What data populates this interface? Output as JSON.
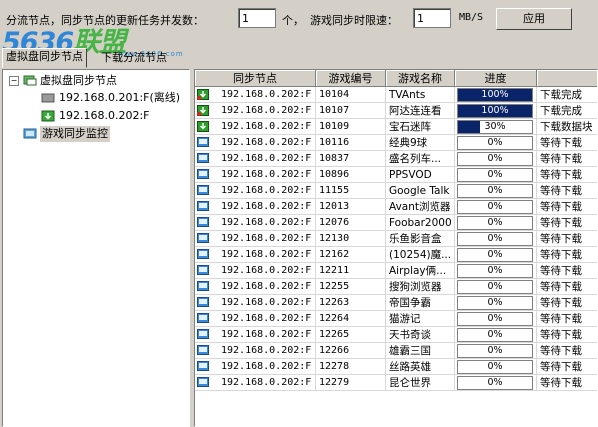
{
  "toolbar": {
    "concurrency_label": "分流节点，同步节点的更新任务并发数：",
    "concurrency_value": "1",
    "concurrency_unit": "个，",
    "speed_label": "游戏同步时限速：",
    "speed_value": "1",
    "speed_unit": "MB/S",
    "apply_label": "应用"
  },
  "watermark": {
    "logo_num": "5636",
    "logo_cn": "联盟",
    "logo_sub": "www.5636.com"
  },
  "tabs": [
    {
      "label": "虚拟盘同步节点"
    },
    {
      "label": "下载分流节点"
    }
  ],
  "tree": {
    "root": "虚拟盘同步节点",
    "children": [
      {
        "label": "192.168.0.201:F(离线)",
        "status": "offline"
      },
      {
        "label": "192.168.0.202:F",
        "status": "online"
      }
    ],
    "monitor": "游戏同步监控"
  },
  "grid": {
    "columns": [
      "同步节点",
      "游戏编号",
      "游戏名称",
      "进度",
      ""
    ],
    "rows": [
      {
        "node": "192.168.0.202:F",
        "id": "10104",
        "name": "TVAnts",
        "progress": 100,
        "progress_text": "100%",
        "status": "下载完成",
        "icon": "download-complete-icon"
      },
      {
        "node": "192.168.0.202:F",
        "id": "10107",
        "name": "阿达连连看",
        "progress": 100,
        "progress_text": "100%",
        "status": "下载完成",
        "icon": "download-complete-icon"
      },
      {
        "node": "192.168.0.202:F",
        "id": "10109",
        "name": "宝石迷阵",
        "progress": 30,
        "progress_text": "30%",
        "status": "下载数据块",
        "icon": "downloading-icon"
      },
      {
        "node": "192.168.0.202:F",
        "id": "10116",
        "name": "经典9球",
        "progress": 0,
        "progress_text": "0%",
        "status": "等待下载",
        "icon": "waiting-icon"
      },
      {
        "node": "192.168.0.202:F",
        "id": "10837",
        "name": "盛名列车...",
        "progress": 0,
        "progress_text": "0%",
        "status": "等待下载",
        "icon": "waiting-icon"
      },
      {
        "node": "192.168.0.202:F",
        "id": "10896",
        "name": "PPSVOD",
        "progress": 0,
        "progress_text": "0%",
        "status": "等待下载",
        "icon": "waiting-icon"
      },
      {
        "node": "192.168.0.202:F",
        "id": "11155",
        "name": "Google Talk",
        "progress": 0,
        "progress_text": "0%",
        "status": "等待下载",
        "icon": "waiting-icon"
      },
      {
        "node": "192.168.0.202:F",
        "id": "12013",
        "name": "Avant浏览器",
        "progress": 0,
        "progress_text": "0%",
        "status": "等待下载",
        "icon": "waiting-icon"
      },
      {
        "node": "192.168.0.202:F",
        "id": "12076",
        "name": "Foobar2000",
        "progress": 0,
        "progress_text": "0%",
        "status": "等待下载",
        "icon": "waiting-icon"
      },
      {
        "node": "192.168.0.202:F",
        "id": "12130",
        "name": "乐鱼影音盒",
        "progress": 0,
        "progress_text": "0%",
        "status": "等待下载",
        "icon": "waiting-icon"
      },
      {
        "node": "192.168.0.202:F",
        "id": "12162",
        "name": "(10254)魔...",
        "progress": 0,
        "progress_text": "0%",
        "status": "等待下载",
        "icon": "waiting-icon"
      },
      {
        "node": "192.168.0.202:F",
        "id": "12211",
        "name": "Airplay俩...",
        "progress": 0,
        "progress_text": "0%",
        "status": "等待下载",
        "icon": "waiting-icon"
      },
      {
        "node": "192.168.0.202:F",
        "id": "12255",
        "name": "搜狗浏览器",
        "progress": 0,
        "progress_text": "0%",
        "status": "等待下载",
        "icon": "waiting-icon"
      },
      {
        "node": "192.168.0.202:F",
        "id": "12263",
        "name": "帝国争霸",
        "progress": 0,
        "progress_text": "0%",
        "status": "等待下载",
        "icon": "waiting-icon"
      },
      {
        "node": "192.168.0.202:F",
        "id": "12264",
        "name": "猫游记",
        "progress": 0,
        "progress_text": "0%",
        "status": "等待下载",
        "icon": "waiting-icon"
      },
      {
        "node": "192.168.0.202:F",
        "id": "12265",
        "name": "天书奇谈",
        "progress": 0,
        "progress_text": "0%",
        "status": "等待下载",
        "icon": "waiting-icon"
      },
      {
        "node": "192.168.0.202:F",
        "id": "12266",
        "name": "雄霸三国",
        "progress": 0,
        "progress_text": "0%",
        "status": "等待下载",
        "icon": "waiting-icon"
      },
      {
        "node": "192.168.0.202:F",
        "id": "12278",
        "name": "丝路英雄",
        "progress": 0,
        "progress_text": "0%",
        "status": "等待下载",
        "icon": "waiting-icon"
      },
      {
        "node": "192.168.0.202:F",
        "id": "12279",
        "name": "昆仑世界",
        "progress": 0,
        "progress_text": "0%",
        "status": "等待下载",
        "icon": "waiting-icon"
      }
    ]
  },
  "colors": {
    "progress_fill": "#0a246a",
    "window_bg": "#d4d0c8"
  }
}
